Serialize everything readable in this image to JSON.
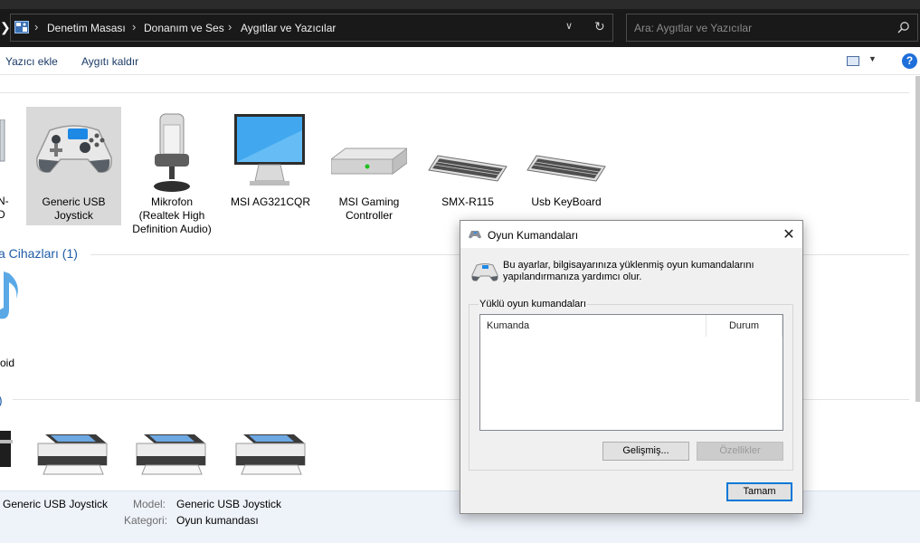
{
  "breadcrumb": [
    "Denetim Masası",
    "Donanım ve Ses",
    "Aygıtlar ve Yazıcılar"
  ],
  "search": {
    "placeholder": "Ara: Aygıtlar ve Yazıcılar"
  },
  "toolbar": {
    "add_printer": "Yazıcı ekle",
    "remove_device": "Aygıtı kaldır",
    "help": "?"
  },
  "devices": [
    {
      "label": "N-D"
    },
    {
      "label": "Generic   USB\nJoystick"
    },
    {
      "label": "Mikrofon\n(Realtek High\nDefinition Audio)"
    },
    {
      "label": "MSI AG321CQR"
    },
    {
      "label": "MSI Gaming\nController"
    },
    {
      "label": "SMX-R115"
    },
    {
      "label": "Usb KeyBoard"
    }
  ],
  "groups": {
    "multimedia": "a Cihazları (1)",
    "printers": ")"
  },
  "multimedia_devices": [
    {
      "label": "oid"
    }
  ],
  "details": {
    "name": "Generic   USB   Joystick",
    "model_key": "Model:",
    "model_value": "Generic   USB   Joystick",
    "category_key": "Kategori:",
    "category_value": "Oyun kumandası"
  },
  "dialog": {
    "title": "Oyun Kumandaları",
    "description": "Bu ayarlar, bilgisayarınıza yüklenmiş oyun kumandalarını yapılandırmanıza yardımcı olur.",
    "group_label": "Yüklü oyun kumandaları",
    "columns": [
      "Kumanda",
      "Durum"
    ],
    "advanced_button": "Gelişmiş...",
    "properties_button": "Özellikler",
    "ok_button": "Tamam"
  },
  "colors": {
    "accent": "#1e5ca8",
    "address_bar": "#191919",
    "details_bg": "#eef3fa"
  }
}
